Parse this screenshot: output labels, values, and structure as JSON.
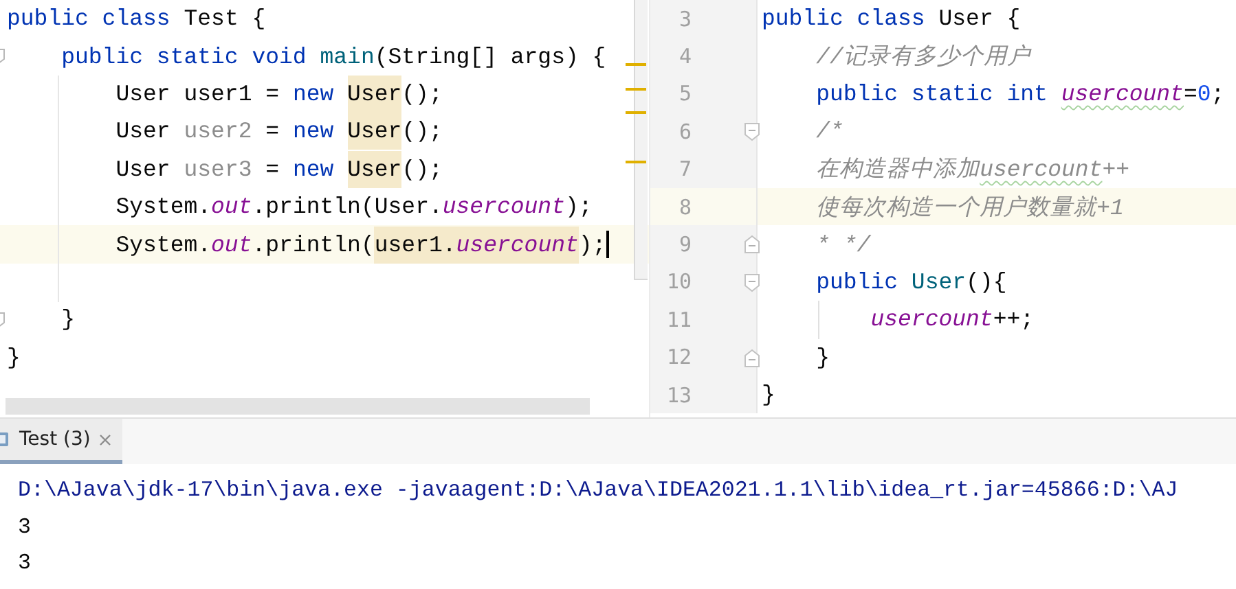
{
  "left_editor": {
    "lines": [
      {
        "current": false,
        "kind": "plain",
        "tokens": [
          {
            "text": "public class ",
            "kind": "keyword",
            "highlighted": false
          },
          {
            "text": "Test {",
            "kind": "plain",
            "highlighted": false
          }
        ]
      },
      {
        "current": false,
        "kind": "opener",
        "tokens": [
          {
            "text": "    public static void ",
            "kind": "keyword",
            "highlighted": false
          },
          {
            "text": "main",
            "kind": "method",
            "highlighted": false
          },
          {
            "text": "(String[] args) {",
            "kind": "plain",
            "highlighted": false
          }
        ]
      },
      {
        "current": false,
        "kind": "plain",
        "tokens": [
          {
            "text": "        User user1 = ",
            "kind": "plain",
            "highlighted": false
          },
          {
            "text": "new ",
            "kind": "keyword",
            "highlighted": false
          },
          {
            "text": "User",
            "kind": "plain",
            "highlighted": true
          },
          {
            "text": "();",
            "kind": "plain",
            "highlighted": false
          }
        ]
      },
      {
        "current": false,
        "kind": "plain",
        "tokens": [
          {
            "text": "        User ",
            "kind": "plain",
            "highlighted": false
          },
          {
            "text": "user2",
            "kind": "unused",
            "highlighted": false
          },
          {
            "text": " = ",
            "kind": "plain",
            "highlighted": false
          },
          {
            "text": "new ",
            "kind": "keyword",
            "highlighted": false
          },
          {
            "text": "User",
            "kind": "plain",
            "highlighted": true
          },
          {
            "text": "();",
            "kind": "plain",
            "highlighted": false
          }
        ]
      },
      {
        "current": false,
        "kind": "plain",
        "tokens": [
          {
            "text": "        User ",
            "kind": "plain",
            "highlighted": false
          },
          {
            "text": "user3",
            "kind": "unused",
            "highlighted": false
          },
          {
            "text": " = ",
            "kind": "plain",
            "highlighted": false
          },
          {
            "text": "new ",
            "kind": "keyword",
            "highlighted": false
          },
          {
            "text": "User",
            "kind": "plain",
            "highlighted": true
          },
          {
            "text": "();",
            "kind": "plain",
            "highlighted": false
          }
        ]
      },
      {
        "current": false,
        "kind": "plain",
        "tokens": [
          {
            "text": "        System.",
            "kind": "plain",
            "highlighted": false
          },
          {
            "text": "out",
            "kind": "field",
            "highlighted": false
          },
          {
            "text": ".println(User.",
            "kind": "plain",
            "highlighted": false
          },
          {
            "text": "usercount",
            "kind": "field",
            "highlighted": false
          },
          {
            "text": ");",
            "kind": "plain",
            "highlighted": false
          }
        ]
      },
      {
        "current": true,
        "kind": "plain",
        "tokens": [
          {
            "text": "        System.",
            "kind": "plain",
            "highlighted": false
          },
          {
            "text": "out",
            "kind": "field",
            "highlighted": false
          },
          {
            "text": ".println(",
            "kind": "plain",
            "highlighted": false
          },
          {
            "text": "user1.",
            "kind": "plain",
            "highlighted": true
          },
          {
            "text": "usercount",
            "kind": "field",
            "highlighted": true
          },
          {
            "text": ");",
            "kind": "plain",
            "highlighted": false
          }
        ]
      },
      {
        "current": false,
        "kind": "plain"
      },
      {
        "current": false,
        "kind": "closer",
        "tokens": [
          {
            "text": "    }",
            "kind": "plain",
            "highlighted": false
          }
        ]
      },
      {
        "current": false,
        "kind": "plain",
        "tokens": [
          {
            "text": "}",
            "kind": "plain",
            "highlighted": false
          }
        ]
      }
    ]
  },
  "right_editor": {
    "lines": [
      {
        "number": "3",
        "current": false,
        "kind": "plain",
        "tokens": [
          {
            "text": "public class ",
            "kind": "keyword",
            "typo": false
          },
          {
            "text": "User {",
            "kind": "plain",
            "typo": false
          }
        ]
      },
      {
        "number": "4",
        "current": false,
        "kind": "plain",
        "tokens": [
          {
            "text": "    //记录有多少个用户",
            "kind": "comment",
            "typo": false
          }
        ]
      },
      {
        "number": "5",
        "current": false,
        "kind": "plain",
        "tokens": [
          {
            "text": "    public static int ",
            "kind": "keyword",
            "typo": false
          },
          {
            "text": "usercount",
            "kind": "field",
            "typo": true
          },
          {
            "text": "=",
            "kind": "plain",
            "typo": false
          },
          {
            "text": "0",
            "kind": "number",
            "typo": false
          },
          {
            "text": ";",
            "kind": "plain",
            "typo": false
          }
        ]
      },
      {
        "number": "6",
        "current": false,
        "kind": "opener",
        "tokens": [
          {
            "text": "    /*",
            "kind": "comment",
            "typo": false
          }
        ]
      },
      {
        "number": "7",
        "current": false,
        "kind": "plain",
        "tokens": [
          {
            "text": "    在构造器中添加",
            "kind": "comment",
            "typo": false
          },
          {
            "text": "usercount",
            "kind": "comment",
            "typo": true
          },
          {
            "text": "++",
            "kind": "comment",
            "typo": false
          }
        ]
      },
      {
        "number": "8",
        "current": true,
        "kind": "plain",
        "tokens": [
          {
            "text": "    使每次构造一个用户数量就+1",
            "kind": "comment",
            "typo": false
          }
        ]
      },
      {
        "number": "9",
        "current": false,
        "kind": "closer",
        "tokens": [
          {
            "text": "    * */",
            "kind": "comment",
            "typo": false
          }
        ]
      },
      {
        "number": "10",
        "current": false,
        "kind": "opener",
        "tokens": [
          {
            "text": "    public ",
            "kind": "keyword",
            "typo": false
          },
          {
            "text": "User",
            "kind": "method",
            "typo": false
          },
          {
            "text": "(){",
            "kind": "plain",
            "typo": false
          }
        ]
      },
      {
        "number": "11",
        "current": false,
        "kind": "plain",
        "tokens": [
          {
            "text": "        usercount",
            "kind": "field",
            "typo": false
          },
          {
            "text": "++;",
            "kind": "plain",
            "typo": false
          }
        ]
      },
      {
        "number": "12",
        "current": false,
        "kind": "closer",
        "tokens": [
          {
            "text": "    }",
            "kind": "plain",
            "typo": false
          }
        ]
      },
      {
        "number": "13",
        "current": false,
        "kind": "plain",
        "tokens": [
          {
            "text": "}",
            "kind": "plain",
            "typo": false
          }
        ]
      }
    ]
  },
  "run_panel": {
    "tabs": [
      {
        "label": "Test (3)",
        "selected": true
      }
    ],
    "console": [
      {
        "text": "D:\\AJava\\jdk-17\\bin\\java.exe -javaagent:D:\\AJava\\IDEA2021.1.1\\lib\\idea_rt.jar=45866:D:\\AJ",
        "kind": "command"
      },
      {
        "text": "3",
        "kind": "output"
      },
      {
        "text": "3",
        "kind": "output"
      }
    ]
  }
}
